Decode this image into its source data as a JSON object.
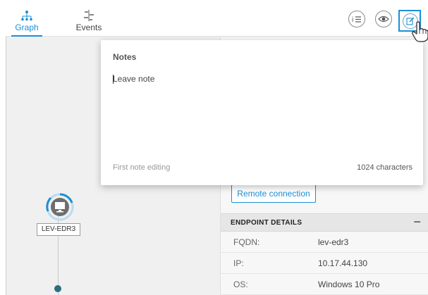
{
  "tabs": [
    {
      "label": "Graph",
      "icon": "graph-tree-icon",
      "active": true
    },
    {
      "label": "Events",
      "icon": "events-list-icon",
      "active": false
    }
  ],
  "toolbar": {
    "buttons": [
      {
        "icon": "list-icon"
      },
      {
        "icon": "eye-icon"
      },
      {
        "icon": "edit-note-icon",
        "active": true
      }
    ]
  },
  "notes": {
    "title": "Notes",
    "placeholder": "Leave note",
    "value": "",
    "status": "First note editing",
    "char_count": "1024 characters"
  },
  "graph": {
    "node_label": "LEV-EDR3",
    "node_icon": "monitor-icon"
  },
  "panel": {
    "remote_button": "Remote connection",
    "section_title": "ENDPOINT DETAILS",
    "collapse_symbol": "−",
    "rows": [
      {
        "key": "FQDN:",
        "value": "lev-edr3"
      },
      {
        "key": "IP:",
        "value": "10.17.44.130"
      },
      {
        "key": "OS:",
        "value": "Windows 10 Pro"
      }
    ]
  },
  "colors": {
    "accent": "#1b8fd6",
    "node_teal": "#2a6f7b"
  }
}
